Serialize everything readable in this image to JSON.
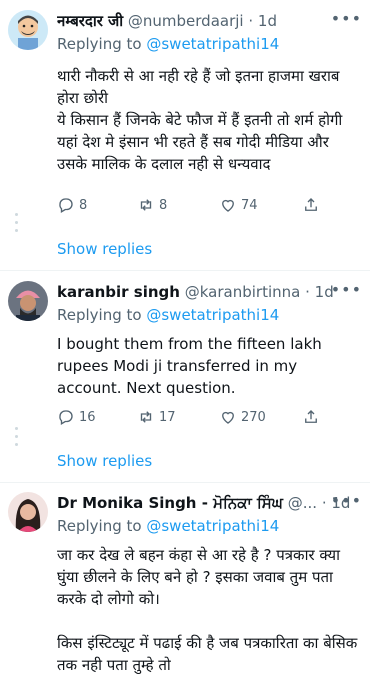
{
  "tweets": [
    {
      "name": "नम्बरदार जी",
      "handle": "@numberdaarji",
      "time": "· 1d",
      "replying_prefix": "Replying to",
      "replying_handle": "@swetatripathi14",
      "body": [
        "थारी नौकरी से आ नही रहे हैं जो इतना हाजमा खराब होरा छोरी",
        "ये किसान हैं जिनके बेटे फौज में हैं इतनी तो  शर्म होगी यहां देश मे इंसान भी रहते हैं सब गोदी मीडिया और उसके मालिक के दलाल नही से धन्यवाद"
      ],
      "replies": "8",
      "retweets": "8",
      "likes": "74",
      "show_replies": "Show replies"
    },
    {
      "name": "karanbir singh",
      "handle": "@karanbirtinna",
      "time": "· 1d",
      "replying_prefix": "Replying to",
      "replying_handle": "@swetatripathi14",
      "body": [
        "I bought them from the fifteen lakh rupees Modi ji transferred in my account. Next question."
      ],
      "replies": "16",
      "retweets": "17",
      "likes": "270",
      "show_replies": "Show replies"
    },
    {
      "name": "Dr Monika Singh - ਮੋਨਿਕਾ ਸਿੰਘ",
      "handle": "@...",
      "time": "· 1d",
      "replying_prefix": "Replying to",
      "replying_handle": "@swetatripathi14",
      "body": [
        "जा कर देख ले बहन कंहा से आ रहे है ? पत्रकार क्या घुंया छीलने के लिए बने हो ? इसका जवाब तुम पता करके दो लोगो को।",
        "किस इंस्टिट्यूट में पढाई की है जब पत्रकारिता का बेसिक तक नही पता तुम्हे तो"
      ]
    }
  ],
  "colors": {
    "link": "#1d9bf0",
    "muted": "#536471",
    "divider": "#eff3f4"
  },
  "icons": {
    "more": "more-horizontal-icon",
    "reply": "reply-icon",
    "retweet": "retweet-icon",
    "like": "heart-icon",
    "share": "share-icon"
  }
}
